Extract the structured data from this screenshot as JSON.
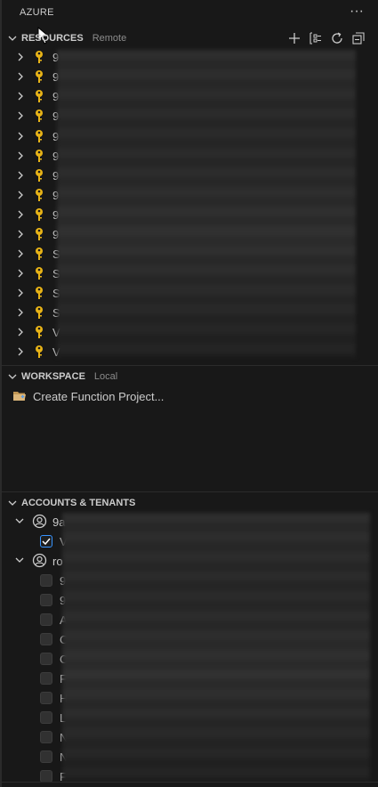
{
  "title": "AZURE",
  "more_label": "···",
  "resources": {
    "header": "RESOURCES",
    "sub": "Remote",
    "actions": [
      "add-icon",
      "group-by-icon",
      "refresh-icon",
      "collapse-all-icon"
    ],
    "items": [
      "9",
      "9",
      "9",
      "9",
      "9",
      "9",
      "9",
      "9",
      "9",
      "9",
      "S",
      "S",
      "S",
      "S",
      "V",
      "V"
    ]
  },
  "workspace": {
    "header": "WORKSPACE",
    "sub": "Local",
    "create_label": "Create Function Project..."
  },
  "accounts": {
    "header": "ACCOUNTS & TENANTS",
    "account1_label": "9a",
    "account1_tenant_label": "V",
    "account2_label": "ro",
    "account2_tenants": [
      "9",
      "9",
      "A",
      "C",
      "C",
      "F",
      "H",
      "L",
      "N",
      "N",
      "F"
    ]
  },
  "colors": {
    "key": "#e8b417",
    "accent": "#3794ff",
    "folder": "#c09553"
  }
}
